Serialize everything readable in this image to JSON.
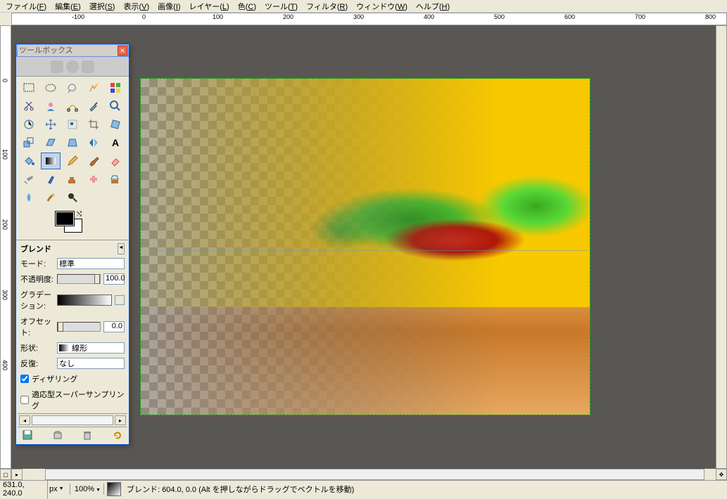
{
  "menu": {
    "items": [
      {
        "label": "ファイル",
        "key": "F"
      },
      {
        "label": "編集",
        "key": "E"
      },
      {
        "label": "選択",
        "key": "S"
      },
      {
        "label": "表示",
        "key": "V"
      },
      {
        "label": "画像",
        "key": "I"
      },
      {
        "label": "レイヤー",
        "key": "L"
      },
      {
        "label": "色",
        "key": "C"
      },
      {
        "label": "ツール",
        "key": "T"
      },
      {
        "label": "フィルタ",
        "key": "R"
      },
      {
        "label": "ウィンドウ",
        "key": "W"
      },
      {
        "label": "ヘルプ",
        "key": "H"
      }
    ]
  },
  "ruler": {
    "h_labels": [
      "-100",
      "0",
      "100",
      "200",
      "300",
      "400",
      "500",
      "600",
      "700",
      "800"
    ],
    "v_labels": [
      "0",
      "100",
      "200",
      "300",
      "400"
    ]
  },
  "toolbox": {
    "title": "ツールボックス",
    "tools": [
      "rect-select",
      "ellipse-select",
      "free-select",
      "fuzzy-select",
      "color-select",
      "scissors",
      "foreground-select",
      "paths",
      "color-picker",
      "zoom",
      "measure",
      "move",
      "align",
      "crop",
      "rotate",
      "scale",
      "shear",
      "perspective",
      "flip",
      "text",
      "bucket-fill",
      "blend",
      "pencil",
      "paintbrush",
      "eraser",
      "airbrush",
      "ink",
      "clone",
      "heal",
      "perspective-clone",
      "blur",
      "smudge",
      "dodge"
    ],
    "selected_tool": "blend",
    "fg_color": "#000000",
    "bg_color": "#ffffff"
  },
  "tool_options": {
    "title": "ブレンド",
    "mode_label": "モード:",
    "mode_value": "標準",
    "opacity_label": "不透明度:",
    "opacity_value": "100.0",
    "gradient_label": "グラデーション:",
    "offset_label": "オフセット:",
    "offset_value": "0.0",
    "shape_label": "形状:",
    "shape_value": "線形",
    "repeat_label": "反復:",
    "repeat_value": "なし",
    "dithering_label": "ディザリング",
    "dithering_checked": true,
    "supersampling_label": "適応型スーパーサンプリング",
    "supersampling_checked": false
  },
  "status": {
    "coords": "631.0, 240.0",
    "unit": "px",
    "zoom": "100%",
    "message": "ブレンド: 604.0, 0.0 (Alt を押しながらドラッグでベクトルを移動)"
  }
}
